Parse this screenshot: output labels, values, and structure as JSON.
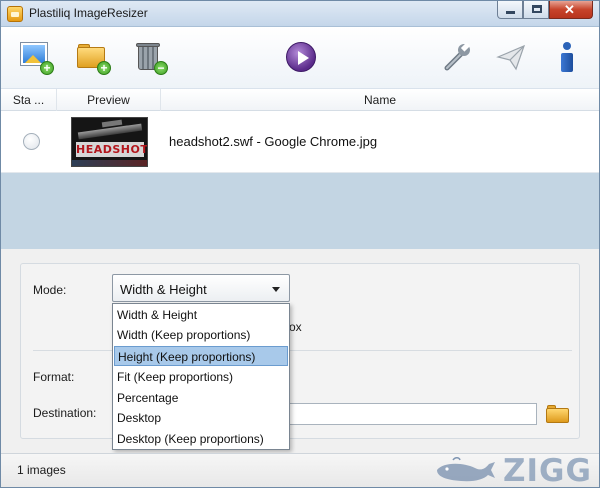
{
  "window": {
    "title": "Plastiliq ImageResizer"
  },
  "toolbar": {
    "icons": [
      "add-images-icon",
      "add-folder-icon",
      "remove-icon",
      "start-icon",
      "settings-icon",
      "send-icon",
      "info-icon"
    ]
  },
  "list": {
    "columns": [
      "Sta ...",
      "Preview",
      "Name"
    ],
    "rows": [
      {
        "thumb_text": "HEADSHOT",
        "name": "headshot2.swf - Google Chrome.jpg"
      }
    ]
  },
  "options": {
    "mode_label": "Mode:",
    "mode_value": "Width & Height",
    "mode_options": [
      "Width & Height",
      "Width (Keep proportions)",
      "Height (Keep proportions)",
      "Fit (Keep proportions)",
      "Percentage",
      "Desktop",
      "Desktop (Keep proportions)"
    ],
    "highlighted_option_index": 2,
    "partial_text": "ox",
    "format_label": "Format:",
    "destination_label": "Destination:",
    "destination_value": ""
  },
  "status": {
    "count": "1 images"
  },
  "watermark": {
    "text": "ZIGG"
  },
  "colors": {
    "highlight": "#a8c9ea",
    "list_bg": "#c3d5e3",
    "accent_purple": "#5a2a8a"
  }
}
